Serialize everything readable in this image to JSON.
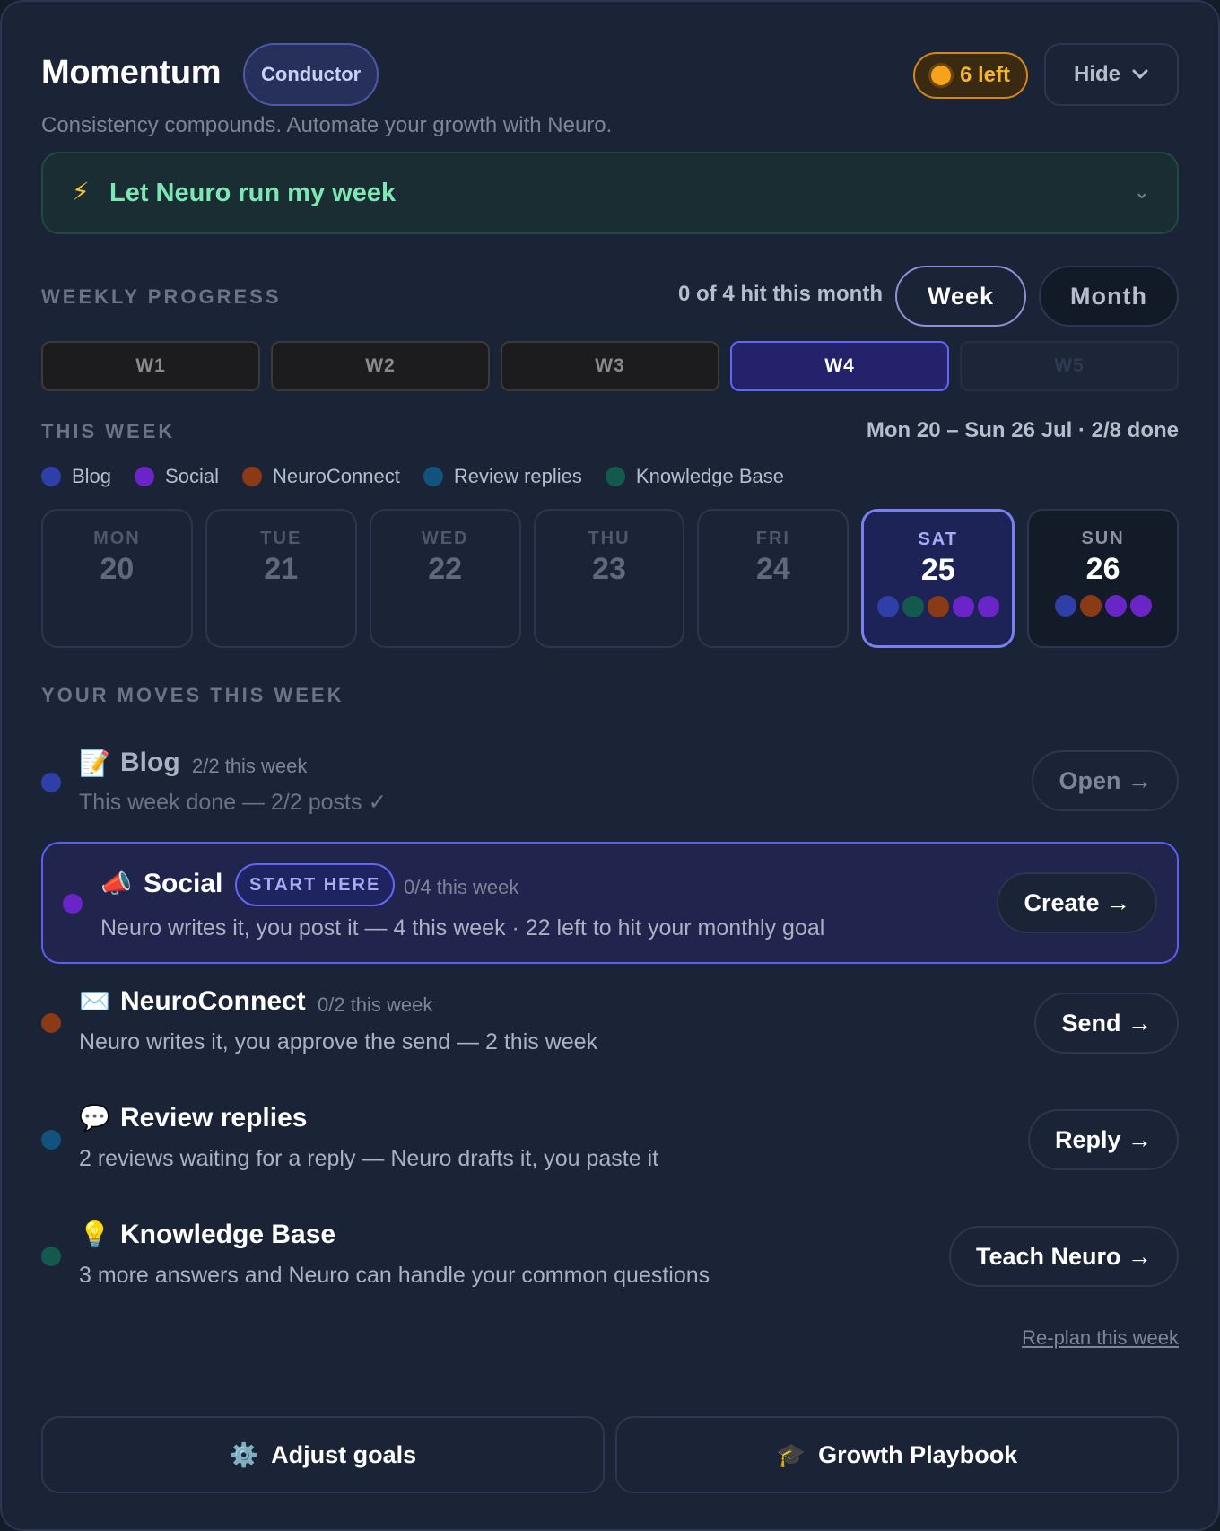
{
  "header": {
    "title": "Momentum",
    "badge": "Conductor",
    "credits": "6 left",
    "hide_label": "Hide",
    "subtitle": "Consistency compounds. Automate your growth with Neuro."
  },
  "neuro_bar": {
    "label": "Let Neuro run my week"
  },
  "weekly_progress": {
    "label": "WEEKLY PROGRESS",
    "hit_text": "0 of 4 hit this month",
    "toggle": [
      "Week",
      "Month"
    ],
    "selected_toggle": "Week",
    "weeks": [
      "W1",
      "W2",
      "W3",
      "W4",
      "W5"
    ],
    "active_week": "W4"
  },
  "this_week": {
    "label": "THIS WEEK",
    "range": "Mon 20 – Sun 26 Jul · 2/8 done",
    "legend": [
      {
        "name": "Blog",
        "color": "#2f3fa8"
      },
      {
        "name": "Social",
        "color": "#6a25c9"
      },
      {
        "name": "NeuroConnect",
        "color": "#8a3a14"
      },
      {
        "name": "Review replies",
        "color": "#11527e"
      },
      {
        "name": "Knowledge Base",
        "color": "#13594e"
      }
    ],
    "days": [
      {
        "name": "MON",
        "num": "20"
      },
      {
        "name": "TUE",
        "num": "21"
      },
      {
        "name": "WED",
        "num": "22"
      },
      {
        "name": "THU",
        "num": "23"
      },
      {
        "name": "FRI",
        "num": "24"
      },
      {
        "name": "SAT",
        "num": "25"
      },
      {
        "name": "SUN",
        "num": "26"
      }
    ],
    "active_day": "SAT"
  },
  "moves": {
    "label": "YOUR MOVES THIS WEEK",
    "blog": {
      "emoji": "📝",
      "title": "Blog",
      "count": "2/2 this week",
      "desc": "This week done — 2/2 posts ✓",
      "button": "Open →"
    },
    "social": {
      "emoji": "📣",
      "title": "Social",
      "badge": "START HERE",
      "count": "0/4 this week",
      "desc": "Neuro writes it, you post it — 4 this week · 22 left to hit your monthly goal",
      "button": "Create →"
    },
    "neuroconnect": {
      "emoji": "✉️",
      "title": "NeuroConnect",
      "count": "0/2 this week",
      "desc": "Neuro writes it, you approve the send — 2 this week",
      "button": "Send →"
    },
    "reviews": {
      "emoji": "💬",
      "title": "Review replies",
      "desc": "2 reviews waiting for a reply — Neuro drafts it, you paste it",
      "button": "Reply →"
    },
    "kb": {
      "emoji": "💡",
      "title": "Knowledge Base",
      "desc": "3 more answers and Neuro can handle your common questions",
      "button": "Teach Neuro →"
    }
  },
  "replan": "Re-plan this week",
  "footer": {
    "adjust_icon": "⚙️",
    "adjust": "Adjust goals",
    "playbook_icon": "🎓",
    "playbook": "Growth Playbook"
  }
}
